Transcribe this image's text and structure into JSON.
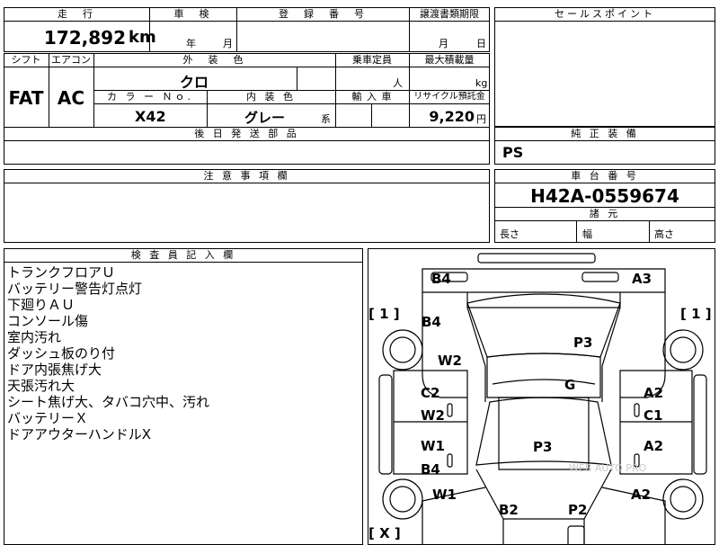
{
  "top_row": {
    "mileage_header": "走　行",
    "mileage_value": "172,892",
    "mileage_unit": "km",
    "inspection_header": "車　検",
    "inspection_year_unit": "年",
    "inspection_month_unit": "月",
    "registration_header": "登　録　番　号",
    "transfer_header": "譲渡書類期限",
    "transfer_month_unit": "月",
    "transfer_day_unit": "日"
  },
  "row2": {
    "shift_header": "シフト",
    "aircon_header": "エアコン",
    "exterior_color_header": "外　装　色",
    "capacity_header": "乗車定員",
    "max_load_header": "最大積載量",
    "shift_value": "FAT",
    "aircon_value": "AC",
    "exterior_color_value": "クロ",
    "capacity_unit": "人",
    "max_load_unit": "kg",
    "color_no_header": "カ ラ ー Ｎｏ.",
    "interior_color_header": "内 装 色",
    "import_header": "輸 入 車",
    "recycle_header": "リサイクル預託金",
    "color_no_value": "X42",
    "interior_color_value": "グレー",
    "interior_suffix": "系",
    "recycle_value": "9,220",
    "recycle_unit": "円",
    "later_parts_header": "後 日 発 送 部 品"
  },
  "right_panel": {
    "sales_point_header": "セールスポイント",
    "genuine_equipment_header": "純 正 装 備",
    "genuine_equipment_value": "PS",
    "chassis_header": "車 台 番 号",
    "chassis_value": "H42A-0559674",
    "dimensions_header": "諸 元",
    "length_label": "長さ",
    "width_label": "幅",
    "height_label": "高さ"
  },
  "notes": {
    "header": "注 意 事 項 欄"
  },
  "inspector": {
    "header": "検 査 員 記 入 欄",
    "lines": [
      "トランクフロアＵ",
      "バッテリー警告灯点灯",
      "下廻りＡＵ",
      "コンソール傷",
      "室内汚れ",
      "ダッシュ板のり付",
      "ドア内張焦げ大",
      "天張汚れ大",
      "シート焦げ大、タバコ穴中、汚れ",
      "バッテリーＸ",
      "ドアアウターハンドルX"
    ]
  },
  "diagram": {
    "codes": {
      "b4_top": "B4",
      "a3_top": "A3",
      "b4_left": "B4",
      "w2_left_upper": "W2",
      "p3_upper": "P3",
      "g": "G",
      "c2": "C2",
      "w2_left_mid": "W2",
      "a2_right_upper": "A2",
      "c1": "C1",
      "w1_left": "W1",
      "b4_left_lower": "B4",
      "p3_center": "P3",
      "a2_right_mid": "A2",
      "w1_left_lower": "W1",
      "a2_right_lower": "A2",
      "b2": "B2",
      "p2": "P2"
    },
    "brackets": {
      "left_upper": "[ 1 ]",
      "right_upper": "[ 1 ]",
      "left_lower": "[ X ]"
    },
    "watermark": "WEB AUTO PRO"
  }
}
